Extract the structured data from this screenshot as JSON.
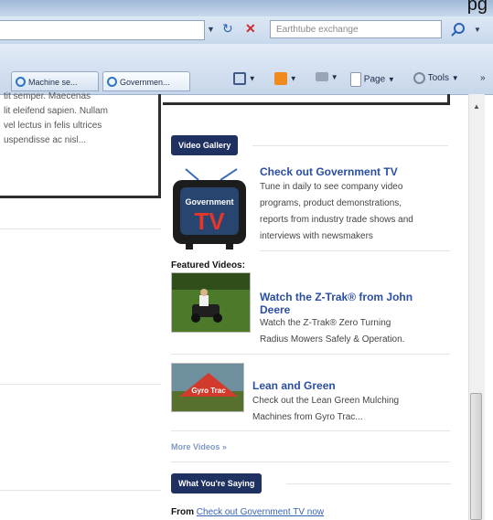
{
  "browser": {
    "page_label_top": "pg",
    "search_placeholder": "Earthtube exchange",
    "tabs": [
      "Machine se...",
      "Governmen..."
    ],
    "commands": {
      "page": "Page",
      "tools": "Tools"
    }
  },
  "page": {
    "left_text": [
      "tit semper. Maecenas",
      "lit eleifend sapien. Nullam",
      "vel lectus in felis ultrices",
      "uspendisse ac nisl..."
    ],
    "video_gallery_label": "Video Gallery",
    "government_tv": {
      "title": "Check out Government TV",
      "description": [
        "Tune in daily to see company video",
        "programs, product demonstrations,",
        "reports from industry trade shows and",
        "interviews with newsmakers"
      ],
      "logo_text_top": "Government",
      "logo_text_big": "TV"
    },
    "featured_label": "Featured Videos:",
    "videos": [
      {
        "title": "Watch the Z-Trak® from John Deere",
        "description": [
          "Watch the Z-Trak® Zero Turning",
          "Radius Mowers Safely & Operation."
        ]
      },
      {
        "title": "Lean and Green",
        "description": [
          "Check out the Lean Green Mulching",
          "Machines from Gyro Trac..."
        ],
        "thumb_text": "Gyro Trac"
      }
    ],
    "more_videos_label": "More Videos »",
    "what_saying_label": "What You're Saying",
    "from_prefix": "From",
    "from_link": "Check out Government TV now"
  },
  "colors": {
    "section_bg": "#1f3160",
    "link": "#2a4ea6"
  }
}
